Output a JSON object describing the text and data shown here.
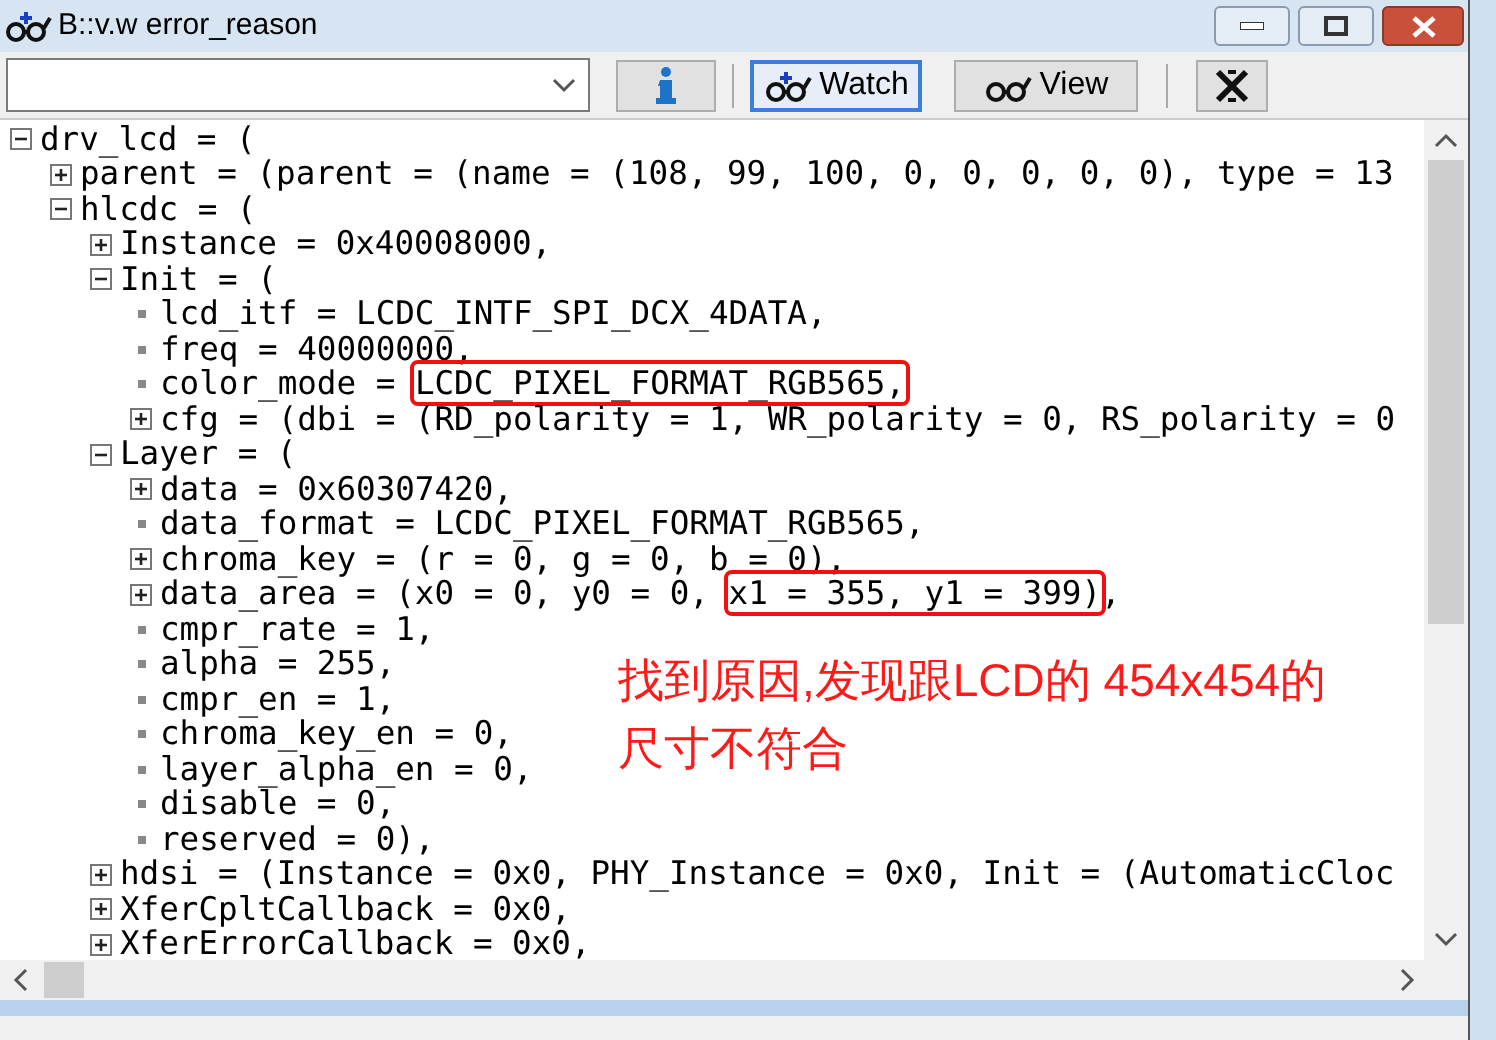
{
  "window": {
    "title": "B::v.w error_reason"
  },
  "toolbar": {
    "buttons": [
      {
        "kind": "info",
        "selected": false
      },
      {
        "kind": "watch",
        "label": "Watch",
        "selected": true
      },
      {
        "kind": "view",
        "label": "View",
        "selected": false
      },
      {
        "kind": "clear",
        "selected": false
      }
    ]
  },
  "tree": [
    {
      "text": "drv_lcd = (",
      "expanded": true,
      "children": [
        {
          "text": "parent = (parent = (name = (108, 99, 100, 0, 0, 0, 0, 0), type = 13",
          "expanded": false
        },
        {
          "text": "hlcdc = (",
          "expanded": true,
          "children": [
            {
              "text": "Instance = 0x40008000,",
              "expanded": false
            },
            {
              "text": "Init = (",
              "expanded": true,
              "children": [
                {
                  "text": "lcd_itf = LCDC_INTF_SPI_DCX_4DATA,"
                },
                {
                  "text": "freq = 40000000,"
                },
                {
                  "text": "color_mode = ",
                  "highlight": "LCDC_PIXEL_FORMAT_RGB565,"
                },
                {
                  "text": "cfg = (dbi = (RD_polarity = 1, WR_polarity = 0, RS_polarity = 0",
                  "expanded": false
                }
              ]
            },
            {
              "text": "Layer = (",
              "expanded": true,
              "children": [
                {
                  "text": "data = 0x60307420,",
                  "expanded": false
                },
                {
                  "text": "data_format = LCDC_PIXEL_FORMAT_RGB565,"
                },
                {
                  "text": "chroma_key = (r = 0, g = 0, b = 0),",
                  "expanded": false
                },
                {
                  "text": "data_area = (x0 = 0, y0 = 0, ",
                  "highlight": "x1 = 355, y1 = 399)",
                  "rest": ",",
                  "expanded": false
                },
                {
                  "text": "cmpr_rate = 1,"
                },
                {
                  "text": "alpha = 255,"
                },
                {
                  "text": "cmpr_en = 1,"
                },
                {
                  "text": "chroma_key_en = 0,"
                },
                {
                  "text": "layer_alpha_en = 0,"
                },
                {
                  "text": "disable = 0,"
                },
                {
                  "text": "reserved = 0),"
                }
              ]
            },
            {
              "text": "hdsi = (Instance = 0x0, PHY_Instance = 0x0, Init = (AutomaticCloc",
              "expanded": false
            },
            {
              "text": "XferCpltCallback = 0x0,",
              "expanded": false
            },
            {
              "text": "XferErrorCallback = 0x0,",
              "expanded": false
            }
          ]
        }
      ]
    }
  ],
  "annotation": {
    "lines": [
      "找到原因,发现跟LCD的 454x454的",
      "尺寸不符合"
    ]
  }
}
